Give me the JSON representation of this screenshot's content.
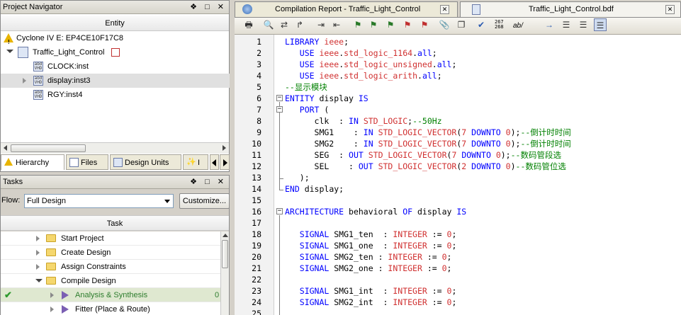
{
  "navigator": {
    "title": "Project Navigator",
    "buttons": "❁◻✕",
    "column_header": "Entity",
    "device": "Cyclone IV E: EP4CE10F17C8",
    "top_entity": "Traffic_Light_Control",
    "instances": [
      "CLOCK:inst",
      "display:inst3",
      "RGY:inst4"
    ],
    "chip_label": "abd\nVHD",
    "tabs": [
      "Hierarchy",
      "Files",
      "Design Units",
      "I"
    ]
  },
  "tasks": {
    "title": "Tasks",
    "flow_label": "Flow:",
    "flow_value": "Full Design",
    "customize_label": "Customize...",
    "column_header": "Task",
    "items": [
      "Start Project",
      "Create Design",
      "Assign Constraints",
      "Compile Design",
      "Analysis & Synthesis",
      "Fitter (Place & Route)"
    ],
    "status_tail": "0"
  },
  "editor": {
    "tabs": [
      "Compilation Report - Traffic_Light_Control",
      "Traffic_Light_Control.bdf"
    ],
    "toolbar_text": [
      "267\n268",
      "ab/"
    ],
    "line_numbers": [
      "1",
      "2",
      "3",
      "4",
      "5",
      "6",
      "7",
      "8",
      "9",
      "10",
      "11",
      "12",
      "13",
      "14",
      "15",
      "16",
      "17",
      "18",
      "19",
      "20",
      "21",
      "22",
      "23",
      "24",
      "25"
    ],
    "comments": {
      "l5": "--显示模块",
      "l8": "--50Hz",
      "l9": "--倒计时时间",
      "l10": "--倒计时时间",
      "l11": "--数码管段选",
      "l12": "--数码管位选"
    }
  },
  "colors": {
    "keyword": "#0000ff",
    "type": "#d03030",
    "comment": "#008000",
    "selected_task": "#dfe8d0",
    "highlight_row": "#e0e0e0"
  }
}
